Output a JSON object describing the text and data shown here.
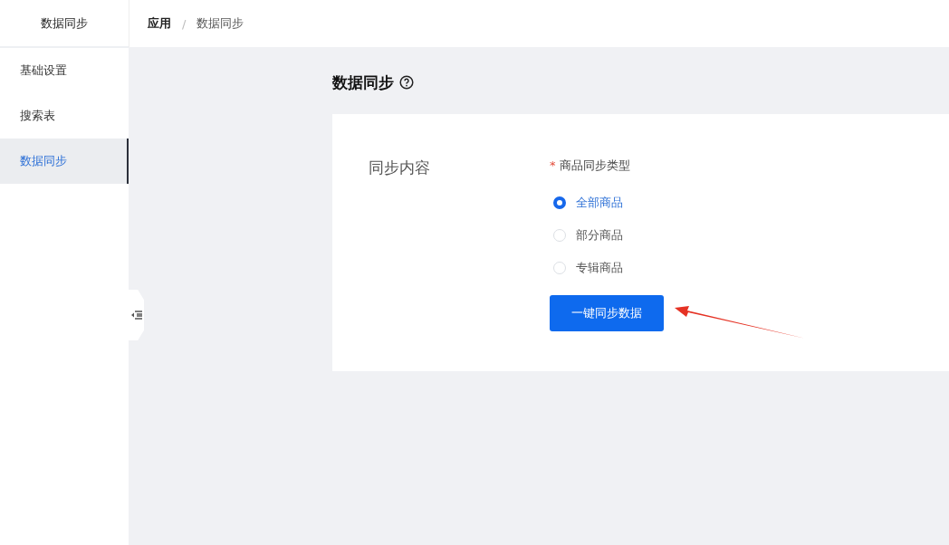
{
  "sidebar": {
    "title": "数据同步",
    "items": [
      {
        "label": "基础设置",
        "selected": false
      },
      {
        "label": "搜索表",
        "selected": false
      },
      {
        "label": "数据同步",
        "selected": true
      }
    ]
  },
  "breadcrumb": [
    "应用",
    "/",
    "数据同步"
  ],
  "page": {
    "title": "数据同步"
  },
  "form": {
    "section_label": "同步内容",
    "field_label": "商品同步类型",
    "required_mark": "*",
    "options": [
      {
        "label": "全部商品",
        "selected": true
      },
      {
        "label": "部分商品",
        "selected": false
      },
      {
        "label": "专辑商品",
        "selected": false
      }
    ],
    "button": "一键同步数据"
  }
}
